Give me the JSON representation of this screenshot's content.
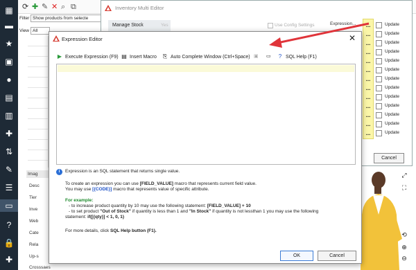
{
  "app": {
    "filter_label": "Filter",
    "filter_value": "Show products from selecte",
    "view_label": "View",
    "view_value": "All",
    "left_tabs": [
      "Imag",
      "Desc",
      "Tier",
      "Inve",
      "Web",
      "Cate",
      "Rela",
      "Up-s",
      "Crosssaes"
    ]
  },
  "inventory_editor": {
    "title": "Inventory Multi Editor",
    "manage_stock_label": "Manage Stock",
    "manage_stock_value": "Yes",
    "use_config_label": "Use Config Settings",
    "expression_label": "Expression...",
    "dots": "...",
    "update_label": "Update",
    "update_rows": 13,
    "cancel_label": "Cancel"
  },
  "expression_editor": {
    "title": "Expression Editor",
    "toolbar": {
      "execute": "Execute Expression (F9)",
      "insert_macro": "Insert Macro",
      "auto_complete": "Auto Complete Window (Ctrl+Space)",
      "sql_help": "SQL Help (F1)"
    },
    "help": {
      "intro": "Expression is an SQL statement that returns single value.",
      "line1_pre": "To create an expression you can use ",
      "line1_macro": "[FIELD_VALUE]",
      "line1_post": " macro that represents current field value.",
      "line2_pre": "You may use ",
      "line2_macro": "[{CODE}]",
      "line2_post": " macro that represents value of specific attribute.",
      "example_title": "For example:",
      "ex1_pre": "- to increase product quantity by 10 may use the following statement: ",
      "ex1_code": "[FIELD_VALUE] + 10",
      "ex2_a": "- to set product ",
      "ex2_b": "\"Out of Stock\"",
      "ex2_c": " if quantity is less than 1 and ",
      "ex2_d": "\"In Stock\"",
      "ex2_e": " if quantity is not lessthan 1 you may use the following",
      "ex3_pre": "statement: ",
      "ex3_code": "if([{qty}] < 1, 0, 1)",
      "details_pre": "For more details, click ",
      "details_link": "SQL Help button (F1).",
      "details_post": ""
    },
    "ok_label": "OK",
    "cancel_label": "Cancel"
  },
  "colors": {
    "sidebar": "#1e2a36",
    "highlight": "#fbf6a8",
    "arrow": "#e0343a",
    "link_blue": "#1a4fc7",
    "example_green": "#1e8a2d"
  },
  "icons": [
    "refresh-icon",
    "add-icon",
    "edit-icon",
    "delete-icon",
    "search-icon",
    "copy-icon",
    "play-icon",
    "macro-icon",
    "autocomplete-icon",
    "save-icon",
    "folder-icon",
    "help-icon",
    "info-icon",
    "close-icon"
  ]
}
